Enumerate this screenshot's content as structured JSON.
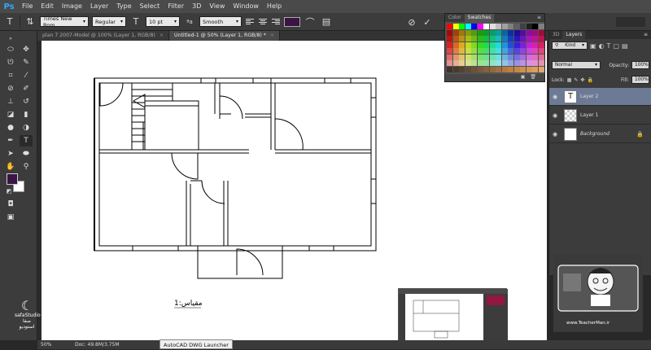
{
  "app": {
    "logo": "Ps"
  },
  "menu": [
    "File",
    "Edit",
    "Image",
    "Layer",
    "Type",
    "Select",
    "Filter",
    "3D",
    "View",
    "Window",
    "Help"
  ],
  "options_bar": {
    "font_family": "Times New Rom...",
    "font_style": "Regular",
    "font_size": "10 pt",
    "aa_label": "ªa",
    "antialias": "Smooth",
    "text_color": "#3a1445"
  },
  "tabs": [
    {
      "label": "plan 7 2007-Model @ 100% (Layer 1, RGB/8)",
      "active": false
    },
    {
      "label": "Untitled-1 @ 50% (Layer 1, RGB/8) *",
      "active": true
    }
  ],
  "swatches_panel": {
    "tabs": [
      "Color",
      "Swatches"
    ]
  },
  "layers_panel": {
    "tabs": [
      "3D",
      "Layers"
    ],
    "filter_kind": "Kind",
    "blend_mode": "Normal",
    "opacity_label": "Opacity:",
    "opacity": "100%",
    "lock_label": "Lock:",
    "fill_label": "Fill:",
    "fill": "100%",
    "layers": [
      {
        "name": "Layer 2",
        "kind": "text",
        "selected": true
      },
      {
        "name": "Layer 1",
        "kind": "pixel",
        "selected": false
      },
      {
        "name": "Background",
        "kind": "background",
        "selected": false
      }
    ]
  },
  "canvas": {
    "scale_label": "1:مقیاس"
  },
  "status": {
    "zoom": "50%",
    "doc": "Doc: 49.8M/3.75M"
  },
  "taskbar_tooltip": "AutoCAD DWG Launcher",
  "watermark": {
    "left_brand": "safaStudio",
    "left_brand_fa": "صفا استودیو",
    "right_url": "www.TeacherMan.ir"
  },
  "colors": {
    "foreground": "#3a1445",
    "background": "#ffffff",
    "accent": "#31a8ff"
  }
}
